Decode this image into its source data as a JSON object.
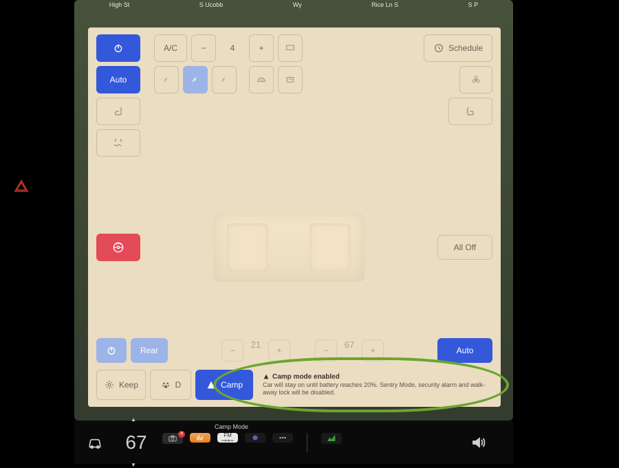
{
  "map_streets": [
    "High St",
    "S Ucobb",
    "Wy",
    "Rice Ln S",
    "S P"
  ],
  "top": {
    "power_icon": "power-icon",
    "ac_label": "A/C",
    "fan_speed": "4",
    "schedule_label": "Schedule",
    "auto_label": "Auto"
  },
  "rear": {
    "rear_label": "Rear",
    "temp_left": "21",
    "temp_right": "67",
    "auto_label": "Auto",
    "all_off_label": "All Off"
  },
  "tabs": {
    "keep_label": "Keep",
    "dog_label": "D",
    "camp_label": "Camp"
  },
  "desc": {
    "title": "Camp mode enabled",
    "body": "Car will stay on until battery reaches 20%. Sentry Mode, security alarm and walk-away lock will be disabled."
  },
  "dock": {
    "camp_mode_label": "Camp Mode",
    "temperature": "67",
    "fm_label": "FM"
  }
}
